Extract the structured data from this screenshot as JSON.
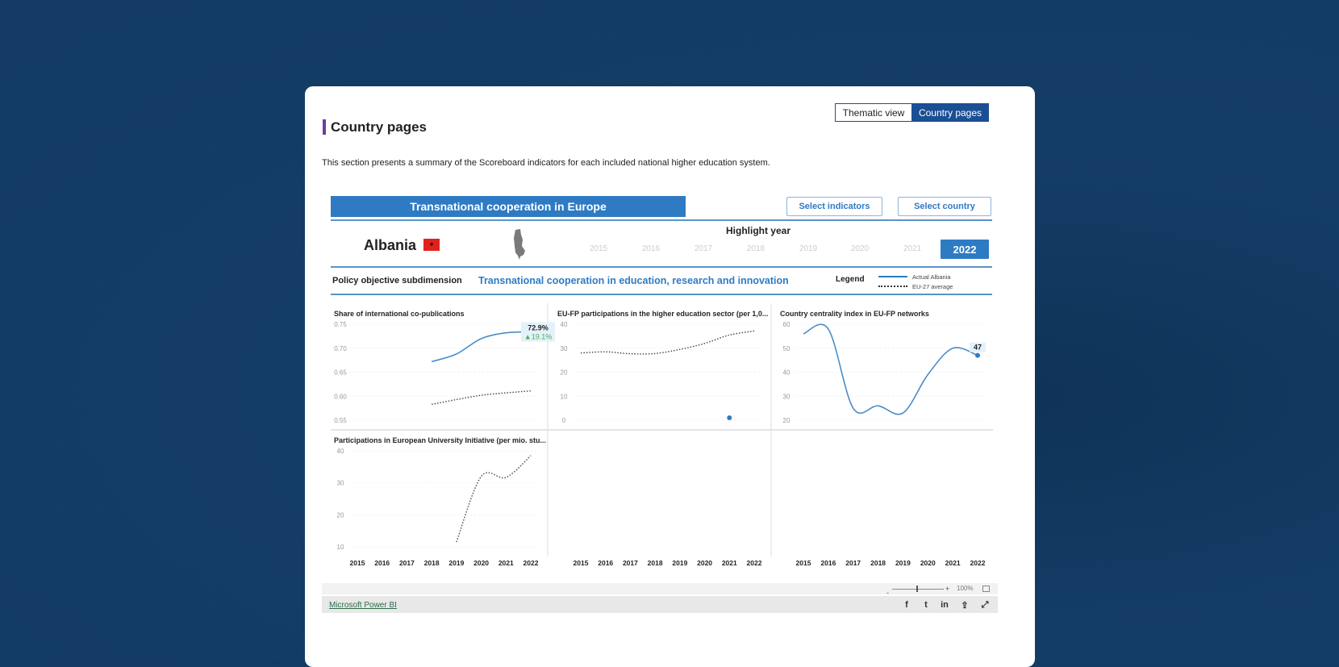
{
  "header": {
    "tabs": [
      {
        "label": "Thematic view",
        "active": false
      },
      {
        "label": "Country pages",
        "active": true
      }
    ],
    "title": "Country pages",
    "description": "This section presents a summary of the Scoreboard indicators for each included national higher education system."
  },
  "report": {
    "banner": "Transnational cooperation in Europe",
    "buttons": {
      "select_indicators": "Select indicators",
      "select_country": "Select country"
    },
    "country": "Albania",
    "highlight_label": "Highlight year",
    "years": [
      "2015",
      "2016",
      "2017",
      "2018",
      "2019",
      "2020",
      "2021"
    ],
    "selected_year": "2022",
    "policy_label": "Policy objective subdimension",
    "subdimension": "Transnational cooperation in education, research and innovation",
    "legend": {
      "title": "Legend",
      "actual": "Actual Albania",
      "eu": "EU-27 average"
    },
    "colors": {
      "accent": "#2e7bc4",
      "dark": "#1b4f93",
      "title_bar": "#6a3fa0"
    }
  },
  "chart_data": [
    {
      "type": "line",
      "title": "Share of international co-publications",
      "x": [
        2015,
        2016,
        2017,
        2018,
        2019,
        2020,
        2021,
        2022
      ],
      "yticks": [
        "0.75",
        "0.70",
        "0.65",
        "0.60",
        "0.55"
      ],
      "ylim": [
        0.55,
        0.75
      ],
      "series": [
        {
          "name": "Actual Albania",
          "style": "solid",
          "values": [
            null,
            null,
            null,
            0.672,
            0.688,
            0.72,
            0.732,
            0.734
          ]
        },
        {
          "name": "EU-27 average",
          "style": "dotted",
          "values": [
            null,
            null,
            null,
            0.583,
            0.593,
            0.602,
            0.607,
            0.611
          ]
        }
      ],
      "annotation": {
        "value": "72.9%",
        "change": "▲19.1%"
      }
    },
    {
      "type": "line",
      "title": "EU-FP participations in the higher education sector (per 1,0...",
      "x": [
        2015,
        2016,
        2017,
        2018,
        2019,
        2020,
        2021,
        2022
      ],
      "yticks": [
        "40",
        "30",
        "20",
        "10",
        "0"
      ],
      "ylim": [
        0,
        40
      ],
      "series": [
        {
          "name": "EU-27 average",
          "style": "dotted",
          "values": [
            28,
            28.5,
            27.7,
            27.8,
            29.5,
            32,
            35.5,
            37.2
          ]
        },
        {
          "name": "Actual Albania",
          "style": "point",
          "values": [
            null,
            null,
            null,
            null,
            null,
            null,
            1,
            null
          ]
        }
      ]
    },
    {
      "type": "line",
      "title": "Country centrality index in EU-FP networks",
      "x": [
        2015,
        2016,
        2017,
        2018,
        2019,
        2020,
        2021,
        2022
      ],
      "yticks": [
        "60",
        "50",
        "40",
        "30",
        "20"
      ],
      "ylim": [
        20,
        60
      ],
      "series": [
        {
          "name": "Actual Albania",
          "style": "solid",
          "values": [
            56,
            58,
            25,
            26,
            23,
            39,
            50,
            47
          ]
        }
      ],
      "annotation": {
        "value": "47"
      }
    },
    {
      "type": "line",
      "title": "Participations in European University Initiative (per mio. stu...",
      "x": [
        2015,
        2016,
        2017,
        2018,
        2019,
        2020,
        2021,
        2022
      ],
      "yticks": [
        "40",
        "30",
        "20",
        "10"
      ],
      "ylim": [
        10,
        40
      ],
      "series": [
        {
          "name": "EU-27 average",
          "style": "dotted",
          "values": [
            null,
            null,
            null,
            null,
            11.5,
            32,
            31.7,
            38.5
          ]
        }
      ]
    }
  ],
  "empty_axes_years": [
    "2015",
    "2016",
    "2017",
    "2018",
    "2019",
    "2020",
    "2021",
    "2022"
  ],
  "footer": {
    "zoom": "100%",
    "powerbi": "Microsoft Power BI",
    "share_icons": [
      "facebook-icon",
      "twitter-icon",
      "linkedin-icon",
      "share-icon",
      "fullscreen-icon"
    ]
  }
}
